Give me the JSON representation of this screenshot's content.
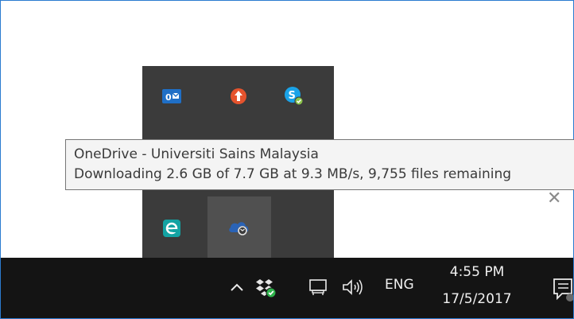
{
  "tooltip": {
    "title": "OneDrive - Universiti Sains Malaysia",
    "status": "Downloading 2.6 GB of 7.7 GB at 9.3 MB/s, 9,755 files remaining"
  },
  "tray_flyout": {
    "icons": [
      "outlook-icon",
      "upload-arrow-icon",
      "skype-icon",
      "eset-icon",
      "onedrive-sync-icon"
    ]
  },
  "taskbar": {
    "language": "ENG",
    "time": "4:55 PM",
    "date": "17/5/2017",
    "icons": [
      "chevron-up-icon",
      "dropbox-sync-icon",
      "network-icon",
      "volume-icon",
      "action-center-icon"
    ]
  },
  "colors": {
    "taskbar_bg": "#141414",
    "flyout_bg": "#3b3b3b",
    "tooltip_bg": "#f4f4f4",
    "outlook_blue": "#1f6fc6",
    "upload_orange": "#e5532d",
    "skype_blue": "#1aa3e8",
    "eset_teal": "#13a3a3",
    "onedrive_blue": "#2a63b6"
  }
}
